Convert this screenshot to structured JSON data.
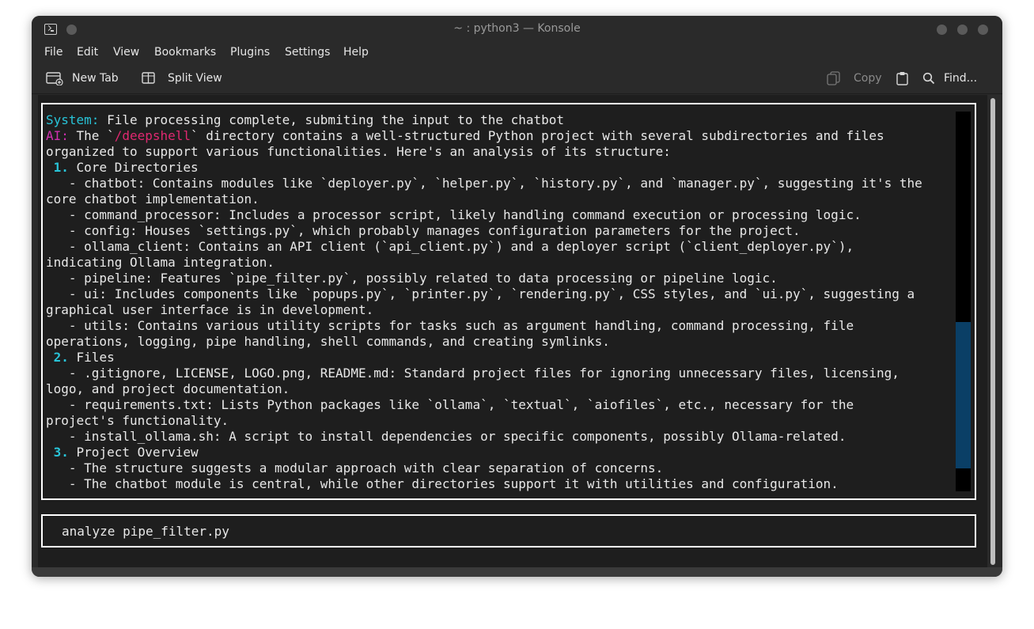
{
  "window": {
    "title": "~ : python3 — Konsole"
  },
  "menubar": {
    "items": [
      "File",
      "Edit",
      "View",
      "Bookmarks",
      "Plugins",
      "Settings",
      "Help"
    ]
  },
  "toolbar": {
    "new_tab_label": "New Tab",
    "split_view_label": "Split View",
    "copy_label": "Copy",
    "find_label": "Find..."
  },
  "terminal": {
    "system_label": "System:",
    "system_msg": " File processing complete, submiting the input to the chatbot",
    "ai_label": "AI:",
    "ai_pre": " The `",
    "ai_path": "/deepshell",
    "ai_post": "` directory contains a well-structured Python project with several subdirectories and files",
    "lines": [
      "organized to support various functionalities. Here's an analysis of its structure:",
      {
        "num": " 1.",
        "text": " Core Directories"
      },
      "   - chatbot: Contains modules like `deployer.py`, `helper.py`, `history.py`, and `manager.py`, suggesting it's the",
      "core chatbot implementation.",
      "   - command_processor: Includes a processor script, likely handling command execution or processing logic.",
      "   - config: Houses `settings.py`, which probably manages configuration parameters for the project.",
      "   - ollama_client: Contains an API client (`api_client.py`) and a deployer script (`client_deployer.py`),",
      "indicating Ollama integration.",
      "   - pipeline: Features `pipe_filter.py`, possibly related to data processing or pipeline logic.",
      "   - ui: Includes components like `popups.py`, `printer.py`, `rendering.py`, CSS styles, and `ui.py`, suggesting a",
      "graphical user interface is in development.",
      "   - utils: Contains various utility scripts for tasks such as argument handling, command processing, file",
      "operations, logging, pipe handling, shell commands, and creating symlinks.",
      {
        "num": " 2.",
        "text": " Files"
      },
      "   - .gitignore, LICENSE, LOGO.png, README.md: Standard project files for ignoring unnecessary files, licensing,",
      "logo, and project documentation.",
      "   - requirements.txt: Lists Python packages like `ollama`, `textual`, `aiofiles`, etc., necessary for the",
      "project's functionality.",
      "   - install_ollama.sh: A script to install dependencies or specific components, possibly Ollama-related.",
      {
        "num": " 3.",
        "text": " Project Overview"
      },
      "   - The structure suggests a modular approach with clear separation of concerns.",
      "   - The chatbot module is central, while other directories support it with utilities and configuration."
    ],
    "input_value": "analyze pipe_filter.py"
  },
  "colors": {
    "system": "#28c4d8",
    "ai": "#d030b0",
    "path": "#e02870",
    "scroll_thumb": "#0a3f66"
  }
}
